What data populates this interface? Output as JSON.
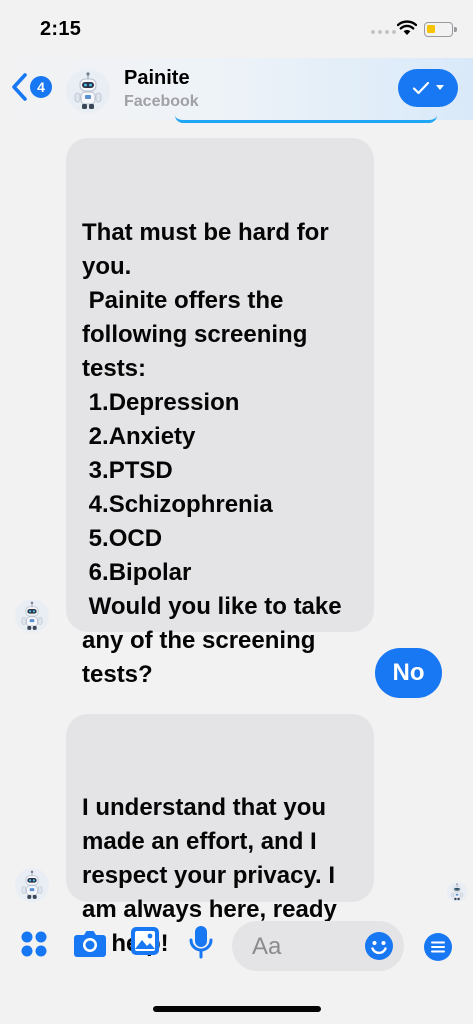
{
  "status_bar": {
    "time": "2:15"
  },
  "header": {
    "back_count": "4",
    "contact_name": "Painite",
    "contact_source": "Facebook"
  },
  "messages": [
    {
      "from": "bot",
      "text": "That must be hard for\nyou.\n Painite offers the\nfollowing screening\ntests:\n 1.Depression\n 2.Anxiety\n 3.PTSD\n 4.Schizophrenia\n 5.OCD\n 6.Bipolar\n Would you like to take\nany of the screening\ntests?"
    },
    {
      "from": "user",
      "text": "No"
    },
    {
      "from": "bot",
      "text": "I understand that you\nmade an effort, and I\nrespect your privacy. I\nam always here, ready\nto help!"
    }
  ],
  "composer": {
    "placeholder": "Aa"
  },
  "colors": {
    "accent": "#1877f2",
    "bubble_in": "#e4e4e6",
    "background": "#f2f2f3"
  },
  "icons": [
    "back-chevron-icon",
    "checkmark-icon",
    "apps-grid-icon",
    "camera-icon",
    "photo-icon",
    "microphone-icon",
    "emoji-icon",
    "menu-icon"
  ]
}
